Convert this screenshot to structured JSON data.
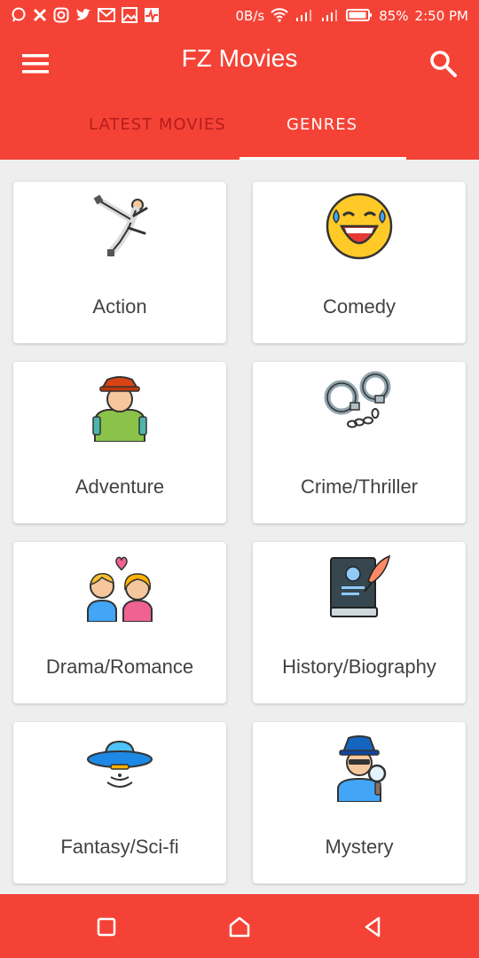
{
  "status_bar": {
    "network_speed": "0B/s",
    "battery": "85%",
    "time": "2:50 PM",
    "notification_icons": [
      "chat-icon",
      "x-icon",
      "instagram-icon",
      "twitter-icon",
      "gmail-icon",
      "gallery-icon",
      "pulse-icon"
    ]
  },
  "app_bar": {
    "title": "FZ Movies",
    "menu_icon": "hamburger-menu-icon",
    "search_icon": "search-icon"
  },
  "tabs": [
    {
      "label": "LATEST MOVIES",
      "selected": false
    },
    {
      "label": "GENRES",
      "selected": true
    }
  ],
  "genres": [
    {
      "label": "Action",
      "icon": "martial-arts-icon"
    },
    {
      "label": "Comedy",
      "icon": "laughing-face-icon"
    },
    {
      "label": "Adventure",
      "icon": "explorer-icon"
    },
    {
      "label": "Crime/Thriller",
      "icon": "handcuffs-icon"
    },
    {
      "label": "Drama/Romance",
      "icon": "couple-icon"
    },
    {
      "label": "History/Biography",
      "icon": "book-quill-icon"
    },
    {
      "label": "Fantasy/Sci-fi",
      "icon": "ufo-icon"
    },
    {
      "label": "Mystery",
      "icon": "detective-icon"
    }
  ],
  "nav_bar": {
    "icons": [
      "recents-square-icon",
      "home-icon",
      "back-triangle-icon"
    ]
  },
  "colors": {
    "primary": "#f44336",
    "background": "#eeeeee",
    "card": "#ffffff",
    "label_text": "#424242"
  }
}
